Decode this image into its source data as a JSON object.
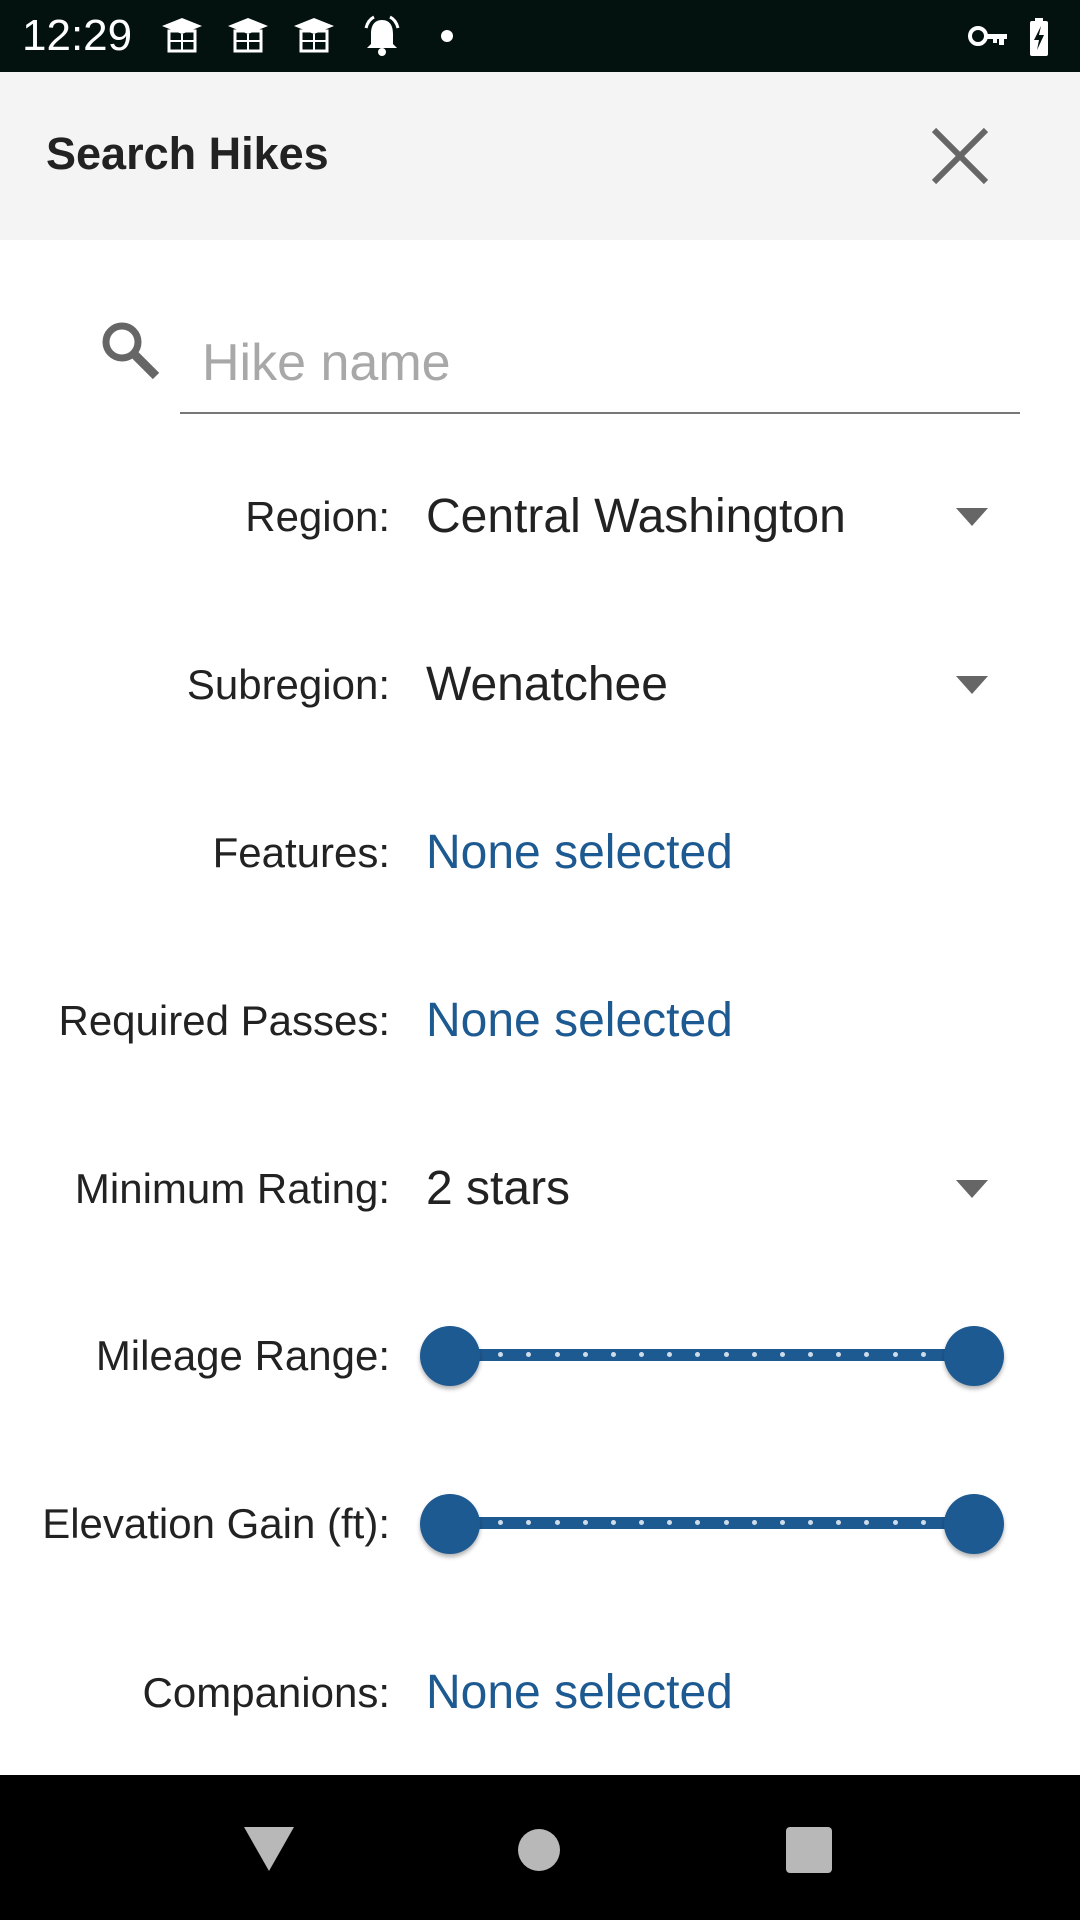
{
  "status_bar": {
    "time": "12:29",
    "icons": [
      "graduation-cap-icon",
      "graduation-cap-icon",
      "graduation-cap-icon",
      "alarm-icon",
      "dot-icon",
      "key-icon",
      "battery-charging-icon"
    ]
  },
  "app_bar": {
    "title": "Search Hikes",
    "close_icon": "close-icon"
  },
  "search": {
    "placeholder": "Hike name",
    "value": ""
  },
  "filters": {
    "region": {
      "label": "Region:",
      "value": "Central Washington"
    },
    "subregion": {
      "label": "Subregion:",
      "value": "Wenatchee"
    },
    "features": {
      "label": "Features:",
      "value": "None selected"
    },
    "required_passes": {
      "label": "Required Passes:",
      "value": "None selected"
    },
    "minimum_rating": {
      "label": "Minimum Rating:",
      "value": "2 stars"
    },
    "mileage_range": {
      "label": "Mileage Range:",
      "min_fraction": 0,
      "max_fraction": 1
    },
    "elevation_gain": {
      "label": "Elevation Gain (ft):",
      "min_fraction": 0,
      "max_fraction": 1
    },
    "companions": {
      "label": "Companions:",
      "value": "None selected"
    }
  },
  "nav_bar": {
    "buttons": [
      "back-icon",
      "home-icon",
      "recents-icon"
    ]
  },
  "colors": {
    "accent": "#1e5a92",
    "status_bar": "#03110f",
    "app_bar": "#f4f4f4"
  }
}
